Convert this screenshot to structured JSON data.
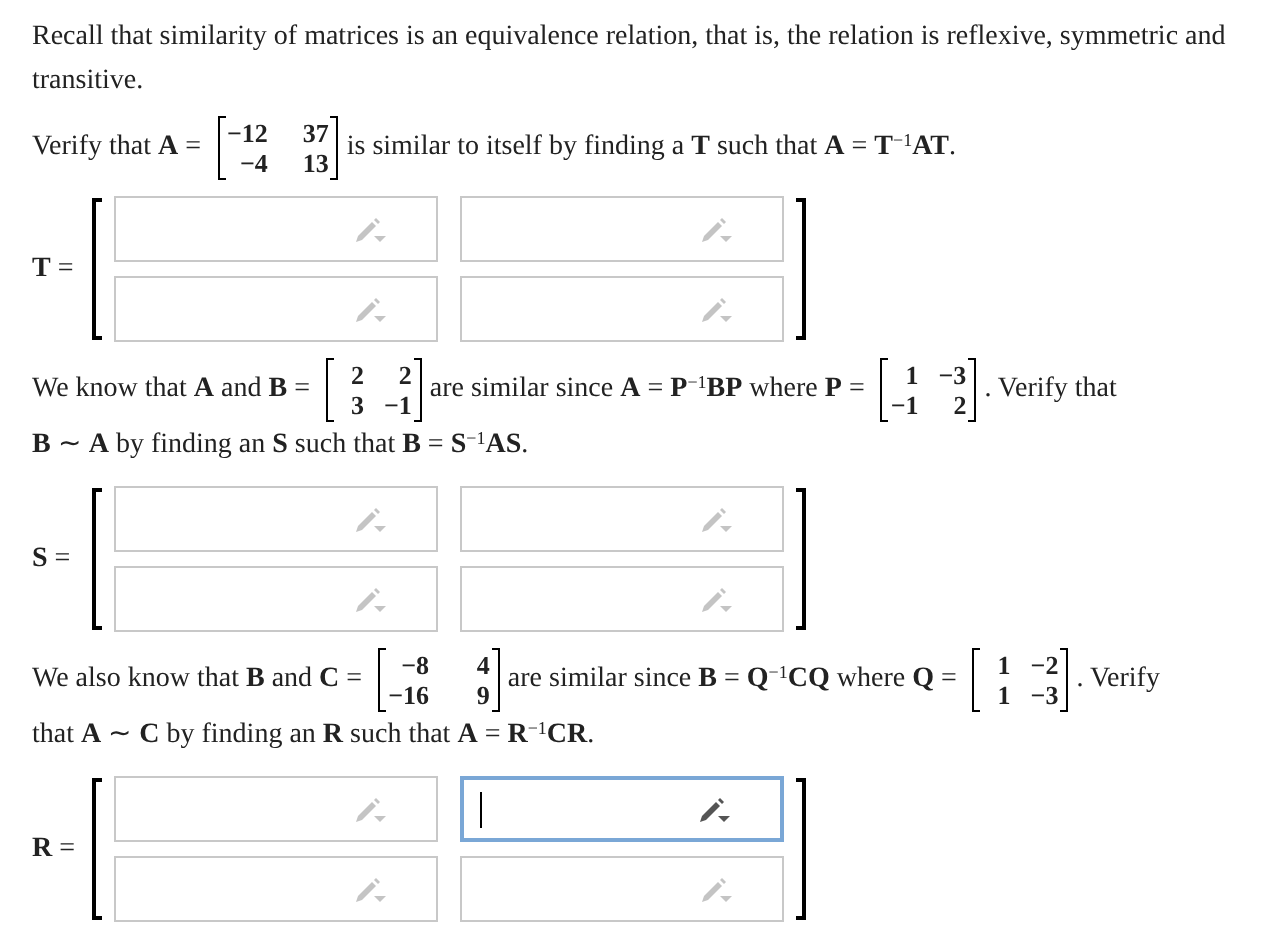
{
  "intro": "Recall that similarity of matrices is an equivalence relation, that is, the relation is reflexive, symmetric and transitive.",
  "problems": [
    {
      "statement": [
        {
          "kind": "text",
          "text": "Verify that **A** ="
        },
        {
          "kind": "matrix",
          "rows": [
            [
              "−12",
              "37"
            ],
            [
              "−4",
              "13"
            ]
          ]
        },
        {
          "kind": "text",
          "text": "is similar to itself by finding a **T** such that **A** = **T**$^{−1}$**AT**."
        }
      ],
      "answer": {
        "label": "**T** =",
        "cells": [
          [
            {
              "focused": false
            },
            {
              "focused": false
            }
          ],
          [
            {
              "focused": false
            },
            {
              "focused": false
            }
          ]
        ]
      }
    },
    {
      "statement": [
        {
          "kind": "text",
          "text": "We know that **A** and **B** ="
        },
        {
          "kind": "matrix",
          "rows": [
            [
              "2",
              "2"
            ],
            [
              "3",
              "−1"
            ]
          ]
        },
        {
          "kind": "text",
          "text": "are similar since **A** = **P**$^{−1}$**BP** where **P** ="
        },
        {
          "kind": "matrix",
          "rows": [
            [
              "1",
              "−3"
            ],
            [
              "−1",
              "2"
            ]
          ]
        },
        {
          "kind": "text",
          "text": ". Verify that"
        },
        {
          "kind": "text",
          "text": "**B** ∼ **A** by finding an **S** such that **B** = **S**$^{−1}$**AS**."
        }
      ],
      "answer": {
        "label": "**S** =",
        "cells": [
          [
            {
              "focused": false
            },
            {
              "focused": false
            }
          ],
          [
            {
              "focused": false
            },
            {
              "focused": false
            }
          ]
        ]
      }
    },
    {
      "statement": [
        {
          "kind": "text",
          "text": "We also know that **B** and **C** ="
        },
        {
          "kind": "matrix",
          "rows": [
            [
              "−8",
              "4"
            ],
            [
              "−16",
              "9"
            ]
          ]
        },
        {
          "kind": "text",
          "text": "are similar since **B** = **Q**$^{−1}$**CQ** where **Q** ="
        },
        {
          "kind": "matrix",
          "rows": [
            [
              "1",
              "−2"
            ],
            [
              "1",
              "−3"
            ]
          ]
        },
        {
          "kind": "text",
          "text": ". Verify"
        },
        {
          "kind": "text",
          "text": "that **A** ∼ **C** by finding an **R** such that **A** = **R**$^{−1}$**CR**."
        }
      ],
      "answer": {
        "label": "**R** =",
        "cells": [
          [
            {
              "focused": false
            },
            {
              "focused": true
            }
          ],
          [
            {
              "focused": false
            },
            {
              "focused": false
            }
          ]
        ]
      }
    }
  ]
}
